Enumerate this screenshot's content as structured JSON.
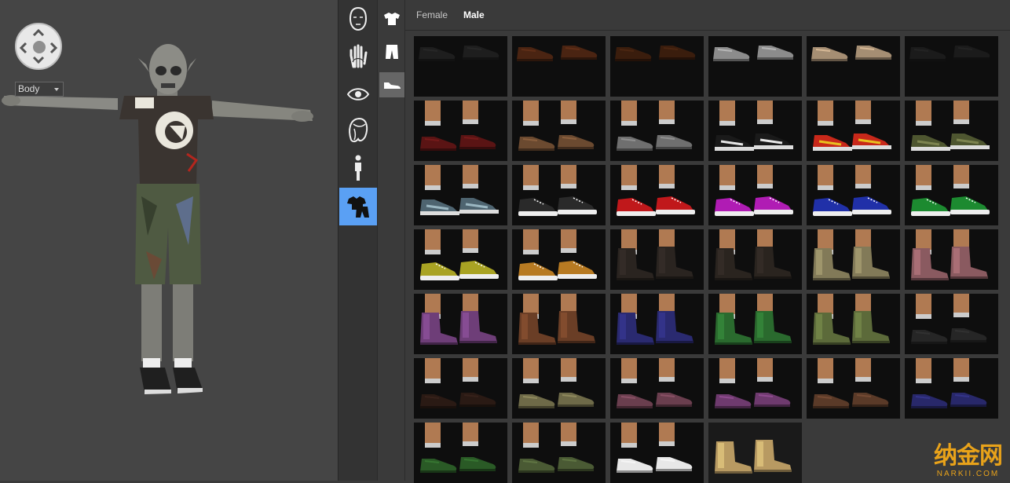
{
  "viewport": {
    "body_select": {
      "value": "Body"
    }
  },
  "categories": [
    {
      "name": "head",
      "icon": "head-icon"
    },
    {
      "name": "skin",
      "icon": "hand-icon"
    },
    {
      "name": "eyes",
      "icon": "eye-icon"
    },
    {
      "name": "hair",
      "icon": "hair-icon"
    },
    {
      "name": "body",
      "icon": "figure-icon"
    },
    {
      "name": "clothing",
      "icon": "clothing-icon",
      "active": true
    }
  ],
  "subcategories": [
    {
      "name": "tops",
      "icon": "shirt-icon"
    },
    {
      "name": "bottoms",
      "icon": "pants-icon"
    },
    {
      "name": "shoes",
      "icon": "shoe-icon",
      "active": true
    }
  ],
  "tabs": [
    {
      "label": "Female",
      "active": false
    },
    {
      "label": "Male",
      "active": true
    }
  ],
  "shoes": [
    {
      "kind": "dress",
      "color": "#1e1e1e",
      "shown": "top"
    },
    {
      "kind": "dress",
      "color": "#4a2412",
      "shown": "top"
    },
    {
      "kind": "dress",
      "color": "#3a1d0d",
      "shown": "top"
    },
    {
      "kind": "dress",
      "color": "#8c8c8c",
      "shown": "top"
    },
    {
      "kind": "dress",
      "color": "#a58e73",
      "shown": "top"
    },
    {
      "kind": "dress",
      "color": "#1b1b1b",
      "shown": "top"
    },
    {
      "kind": "dress",
      "color": "#5a1414"
    },
    {
      "kind": "dress",
      "color": "#6b4a30"
    },
    {
      "kind": "dress",
      "color": "#6f6f6f"
    },
    {
      "kind": "sneaker",
      "color": "#1a1a1a",
      "accent": "#e6e6e6"
    },
    {
      "kind": "sneaker",
      "color": "#c8281a",
      "accent": "#e8c020"
    },
    {
      "kind": "sneaker",
      "color": "#4e5630",
      "accent": "#7d8450"
    },
    {
      "kind": "sneaker",
      "color": "#4e6470",
      "accent": "#9bb7c2"
    },
    {
      "kind": "canvas",
      "color": "#2a2a2a"
    },
    {
      "kind": "canvas",
      "color": "#c0181b"
    },
    {
      "kind": "canvas",
      "color": "#b01cb4"
    },
    {
      "kind": "canvas",
      "color": "#2030a8"
    },
    {
      "kind": "canvas",
      "color": "#1c8a30"
    },
    {
      "kind": "canvas",
      "color": "#a9a323"
    },
    {
      "kind": "canvas",
      "color": "#b77a22"
    },
    {
      "kind": "boot",
      "color": "#2a2420"
    },
    {
      "kind": "boot",
      "color": "#2a241f"
    },
    {
      "kind": "boot",
      "color": "#827a58"
    },
    {
      "kind": "boot",
      "color": "#8a5a60"
    },
    {
      "kind": "boot",
      "color": "#6e3e78"
    },
    {
      "kind": "boot",
      "color": "#6a3e26"
    },
    {
      "kind": "boot",
      "color": "#2a2a70"
    },
    {
      "kind": "boot",
      "color": "#2a6a2e"
    },
    {
      "kind": "boot",
      "color": "#5c6a3a"
    },
    {
      "kind": "dress",
      "color": "#262626"
    },
    {
      "kind": "oxford",
      "color": "#2a1a14"
    },
    {
      "kind": "oxford",
      "color": "#6e6a48"
    },
    {
      "kind": "oxford",
      "color": "#6a3e4e"
    },
    {
      "kind": "oxford",
      "color": "#6e3a6e"
    },
    {
      "kind": "oxford",
      "color": "#5a3a28"
    },
    {
      "kind": "oxford",
      "color": "#28286a"
    },
    {
      "kind": "oxford",
      "color": "#2a5a26"
    },
    {
      "kind": "oxford",
      "color": "#4a5a34"
    },
    {
      "kind": "oxford",
      "color": "#e8e8e8"
    },
    {
      "kind": "boot",
      "color": "#b89a62",
      "bg": "#1a1a1a",
      "nolegs": true
    }
  ],
  "watermark": {
    "text": "纳金网",
    "url": "NARKII.COM"
  }
}
